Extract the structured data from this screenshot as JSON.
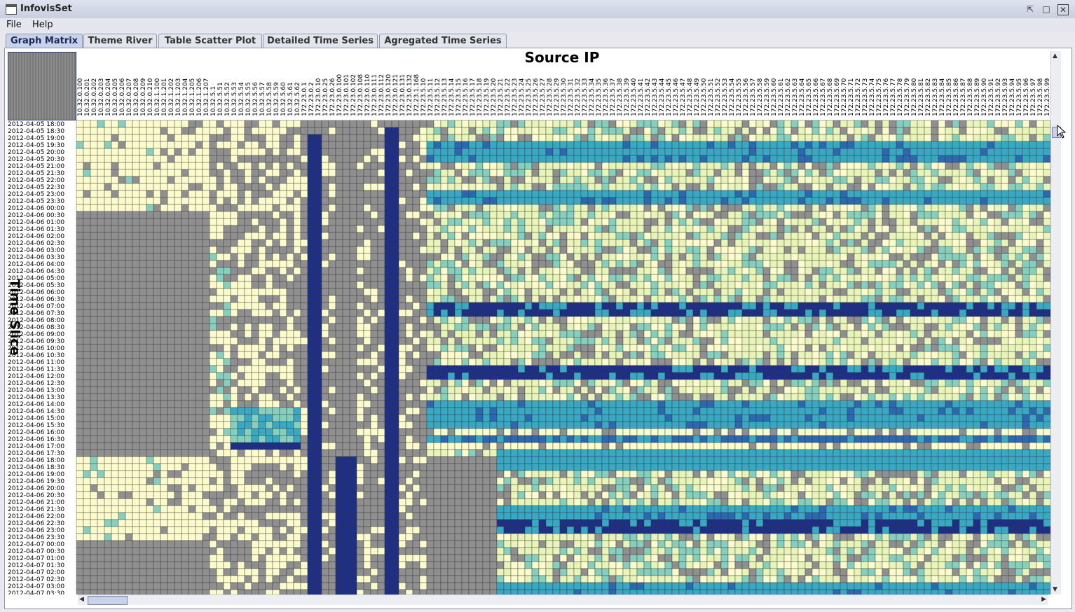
{
  "window": {
    "title": "InfovisSet"
  },
  "menu": [
    "File",
    "Help"
  ],
  "tabs": [
    "Graph Matrix",
    "Theme River",
    "Table Scatter Plot",
    "Detailed Time Series",
    "Agregated Time Series"
  ],
  "active_tab": 0,
  "matrix": {
    "column_title": "Source IP",
    "row_title": "Time Slice",
    "time_start": "2012-04-05 18:00",
    "row_count": 68,
    "columns": [
      "10.32.0.100",
      "10.32.0.201",
      "10.32.0.202",
      "10.32.0.203",
      "10.32.0.204",
      "10.32.0.205",
      "10.32.0.206",
      "10.32.0.207",
      "10.32.0.208",
      "10.32.0.209",
      "10.32.0.210",
      "10.32.1.100",
      "10.32.1.201",
      "10.32.1.202",
      "10.32.1.203",
      "10.32.1.204",
      "10.32.1.205",
      "10.32.1.206",
      "10.32.1.207",
      "10.32.5.1",
      "10.32.5.51",
      "10.32.5.52",
      "10.32.5.53",
      "10.32.5.54",
      "10.32.5.55",
      "10.32.5.56",
      "10.32.5.57",
      "10.32.5.58",
      "10.32.5.59",
      "10.32.5.60",
      "10.32.5.61",
      "10.32.5.62",
      "172.23.0.1",
      "172.23.0.2",
      "172.23.0.10",
      "172.23.0.25",
      "172.23.0.26",
      "172.23.0.100",
      "172.23.0.101",
      "172.23.0.102",
      "172.23.0.108",
      "172.23.0.110",
      "172.23.0.111",
      "172.23.0.112",
      "172.23.0.120",
      "172.23.0.121",
      "172.23.0.131",
      "172.23.0.132",
      "172.23.1.168",
      "172.23.5.10",
      "172.23.5.11",
      "172.23.5.12",
      "172.23.5.13",
      "172.23.5.14",
      "172.23.5.15",
      "172.23.5.16",
      "172.23.5.17",
      "172.23.5.18",
      "172.23.5.19",
      "172.23.5.20",
      "172.23.5.21",
      "172.23.5.22",
      "172.23.5.23",
      "172.23.5.24",
      "172.23.5.25",
      "172.23.5.26",
      "172.23.5.27",
      "172.23.5.28",
      "172.23.5.29",
      "172.23.5.30",
      "172.23.5.31",
      "172.23.5.32",
      "172.23.5.33",
      "172.23.5.34",
      "172.23.5.35",
      "172.23.5.36",
      "172.23.5.37",
      "172.23.5.38",
      "172.23.5.39",
      "172.23.5.40",
      "172.23.5.41",
      "172.23.5.42",
      "172.23.5.43",
      "172.23.5.44",
      "172.23.5.45",
      "172.23.5.46",
      "172.23.5.47",
      "172.23.5.48",
      "172.23.5.49",
      "172.23.5.50",
      "172.23.5.51",
      "172.23.5.52",
      "172.23.5.53",
      "172.23.5.54",
      "172.23.5.55",
      "172.23.5.56",
      "172.23.5.57",
      "172.23.5.58",
      "172.23.5.59",
      "172.23.5.60",
      "172.23.5.61",
      "172.23.5.62",
      "172.23.5.63",
      "172.23.5.64",
      "172.23.5.65",
      "172.23.5.66",
      "172.23.5.67",
      "172.23.5.68",
      "172.23.5.69",
      "172.23.5.70",
      "172.23.5.71",
      "172.23.5.72",
      "172.23.5.73",
      "172.23.5.74",
      "172.23.5.75",
      "172.23.5.76",
      "172.23.5.77",
      "172.23.5.78",
      "172.23.5.79",
      "172.23.5.80",
      "172.23.5.81",
      "172.23.5.82",
      "172.23.5.83",
      "172.23.5.84",
      "172.23.5.85",
      "172.23.5.86",
      "172.23.5.87",
      "172.23.5.88",
      "172.23.5.89",
      "172.23.5.90",
      "172.23.5.91",
      "172.23.5.92",
      "172.23.5.93",
      "172.23.5.94",
      "172.23.5.95",
      "172.23.5.96",
      "172.23.5.97",
      "172.23.5.98",
      "172.23.5.99",
      "172.23.5.100"
    ]
  },
  "colors": {
    "empty": "#8f8f8f",
    "low": "#fbfbcc",
    "light": "#e9f5b8",
    "mid": "#84cfbd",
    "teal": "#39a8c4",
    "blue": "#2a68b2",
    "dark": "#1d2f86",
    "grid": "#333333"
  },
  "scroll": {
    "vertical": "scrollbar",
    "horizontal": "scrollbar"
  }
}
